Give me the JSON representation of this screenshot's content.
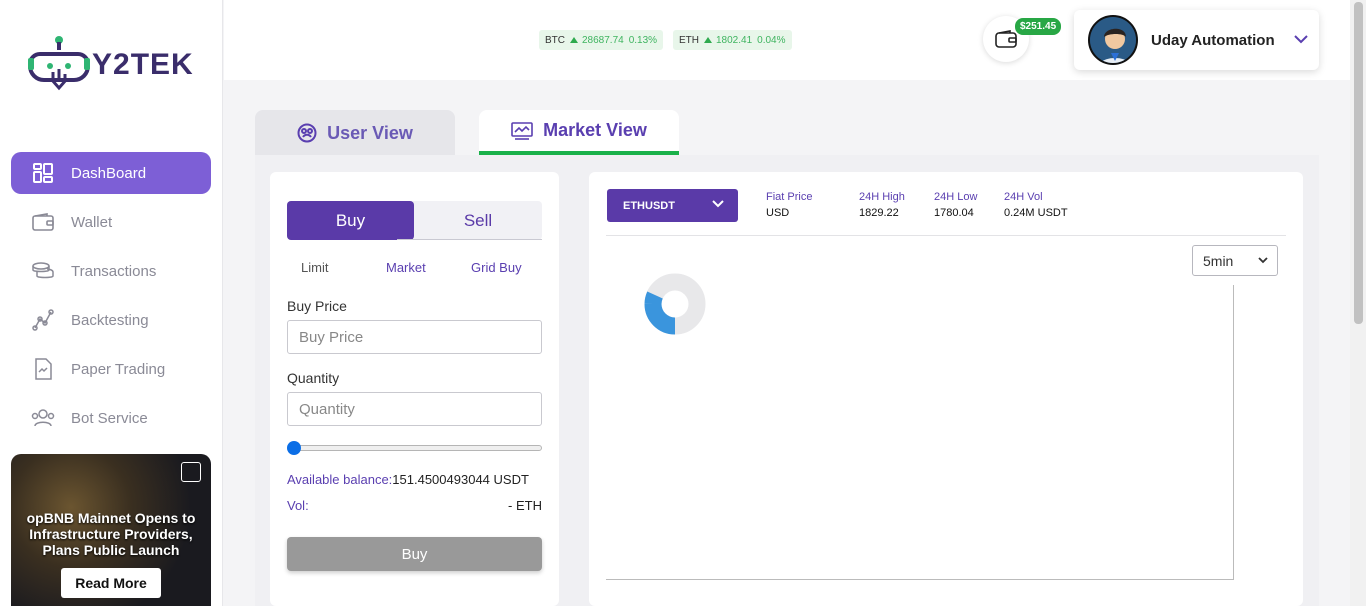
{
  "brand": {
    "logo_text": "Y2TEK"
  },
  "sidebar": {
    "items": [
      {
        "label": "DashBoard",
        "icon": "dashboard-icon",
        "active": true
      },
      {
        "label": "Wallet",
        "icon": "wallet-icon",
        "active": false
      },
      {
        "label": "Transactions",
        "icon": "coins-icon",
        "active": false
      },
      {
        "label": "Backtesting",
        "icon": "chart-line-icon",
        "active": false
      },
      {
        "label": "Paper Trading",
        "icon": "document-icon",
        "active": false
      },
      {
        "label": "Bot Service",
        "icon": "users-icon",
        "active": false
      }
    ],
    "promo": {
      "title": "opBNB Mainnet Opens to Infrastructure Providers, Plans Public Launch",
      "button": "Read More"
    }
  },
  "header": {
    "tickers": [
      {
        "symbol": "BTC",
        "price": "28687.74",
        "change": "0.13%"
      },
      {
        "symbol": "ETH",
        "price": "1802.41",
        "change": "0.04%"
      }
    ],
    "wallet_balance": "$251.45",
    "user_name": "Uday Automation"
  },
  "tabs": {
    "user_view": "User View",
    "market_view": "Market View"
  },
  "trade": {
    "buy_label": "Buy",
    "sell_label": "Sell",
    "order_types": [
      "Limit",
      "Market",
      "Grid Buy"
    ],
    "buy_price_label": "Buy Price",
    "buy_price_placeholder": "Buy Price",
    "quantity_label": "Quantity",
    "quantity_placeholder": "Quantity",
    "slider_value": 0,
    "available_label": "Available balance:",
    "available_value": "151.4500493044 USDT",
    "vol_label": "Vol:",
    "vol_value": "- ETH",
    "submit_label": "Buy"
  },
  "market": {
    "pair": "ETHUSDT",
    "stats": [
      {
        "label": "Fiat Price",
        "value": "USD"
      },
      {
        "label": "24H High",
        "value": "1829.22"
      },
      {
        "label": "24H Low",
        "value": "1780.04"
      },
      {
        "label": "24H Vol",
        "value": "0.24M USDT"
      }
    ],
    "interval": "5min"
  },
  "colors": {
    "accent": "#5a3aa8",
    "active_nav": "#7d5fd6",
    "positive": "#2eaa4e",
    "tab_underline": "#1ab14a"
  }
}
